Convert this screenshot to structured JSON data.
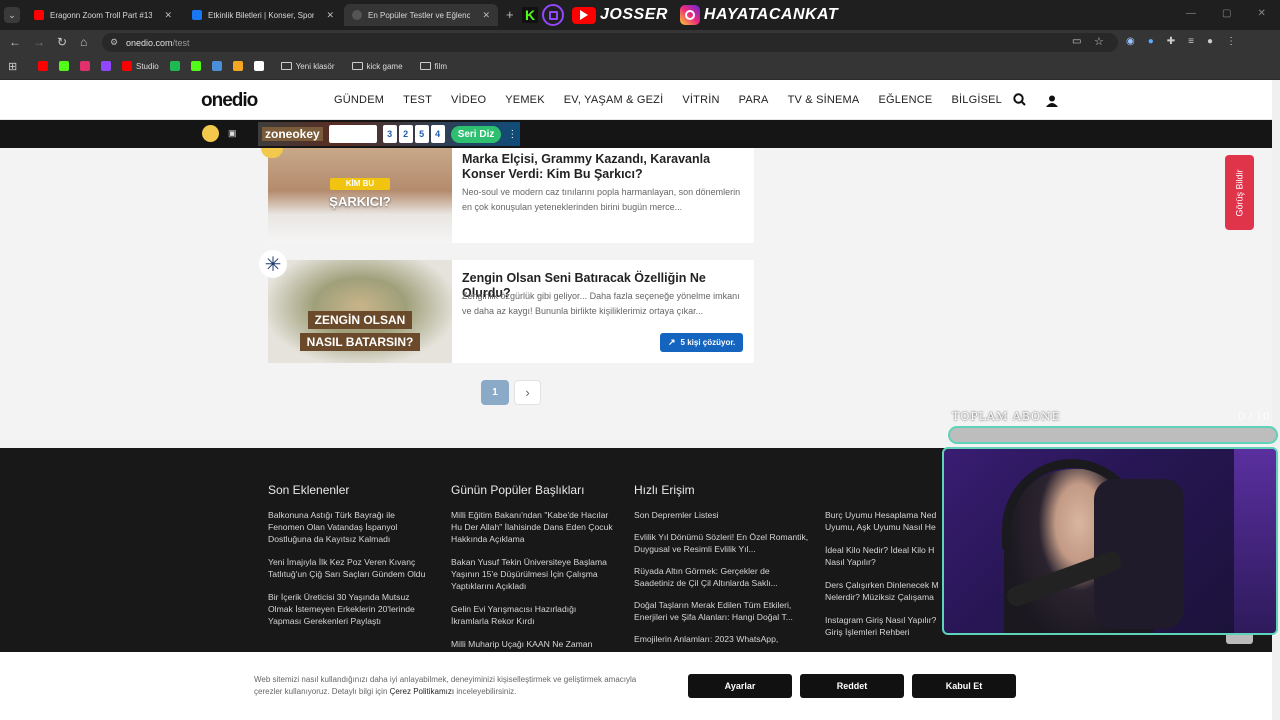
{
  "browser": {
    "tabs": [
      {
        "title": "Eragonn Zoom Troll Part #13 - Y",
        "favicon_color": "#ff0000"
      },
      {
        "title": "Etkinlik Biletleri | Konser, Spor, T",
        "favicon_color": "#1877f2"
      },
      {
        "title": "En Popüler Testler ve Eğlenceli T",
        "favicon_color": "#222222"
      }
    ],
    "new_tab": "+",
    "overlay_names": [
      "JOSSER",
      "HAYATACANKAT"
    ],
    "url_host": "onedio.com",
    "url_path": "/test",
    "bookmarks": [
      {
        "label": "",
        "color": "#ff0000"
      },
      {
        "label": "",
        "color": "#53fc18"
      },
      {
        "label": "",
        "color": "#e1306c"
      },
      {
        "label": "",
        "color": "#9146ff"
      },
      {
        "label": "Studio",
        "color": "#ff0000"
      },
      {
        "label": "",
        "color": "#1db954"
      },
      {
        "label": "",
        "color": "#53fc18"
      },
      {
        "label": "",
        "color": "#4a90d9"
      },
      {
        "label": "",
        "color": "#f5a623"
      },
      {
        "label": "",
        "color": "#ffffff"
      },
      {
        "label": "Yeni klasör",
        "color": "folder"
      },
      {
        "label": "kick game",
        "color": "folder"
      },
      {
        "label": "film",
        "color": "folder"
      }
    ]
  },
  "site": {
    "logo": "onedio",
    "menu": [
      "GÜNDEM",
      "TEST",
      "VİDEO",
      "YEMEK",
      "EV, YAŞAM & GEZİ",
      "VİTRİN",
      "PARA",
      "TV & SİNEMA",
      "EĞLENCE",
      "BİLGİSEL"
    ],
    "ad": {
      "brand": "zoneokey",
      "tiles": [
        "3",
        "2",
        "5",
        "4"
      ],
      "cta": "Seri Diz"
    },
    "cards": [
      {
        "title": "Marka Elçisi, Grammy Kazandı, Karavanla Konser Verdi: Kim Bu Şarkıcı?",
        "desc": "Neo-soul ve modern caz tınılarını popla harmanlayan, son dönemlerin en çok konuşulan yeteneklerinden birini bugün merce...",
        "img_small": "KİM BU",
        "img_big": "ŞARKICI?"
      },
      {
        "title": "Zengin Olsan Seni Batıracak Özelliğin Ne Olurdu?",
        "desc": "Zenginlik özgürlük gibi geliyor... Daha fazla seçeneğe yönelme imkanı ve daha az kaygı! Bununla birlikte kişiliklerimiz ortaya çıkar...",
        "img_line1": "ZENGİN OLSAN",
        "img_line2": "NASIL BATARSIN?",
        "badge": "5 kişi çözüyor."
      }
    ],
    "pagination": {
      "current": "1",
      "next": "›"
    },
    "feedback": "Görüş Bildir",
    "footer": {
      "columns": [
        {
          "heading": "Son Eklenenler",
          "links": [
            "Balkonuna Astığı Türk Bayrağı ile Fenomen Olan Vatandaş İspanyol Dostluğuna da Kayıtsız Kalmadı",
            "Yeni İmajıyla İlk Kez Poz Veren Kıvanç Tatlıtuğ'un Çiğ Sarı Saçları Gündem Oldu",
            "Bir İçerik Üreticisi 30 Yaşında Mutsuz Olmak İstemeyen Erkeklerin 20'lerinde Yapması Gerekenleri Paylaştı"
          ]
        },
        {
          "heading": "Günün Popüler Başlıkları",
          "links": [
            "Milli Eğitim Bakanı'ndan \"Kabe'de Hacılar Hu Der Allah\" İlahisinde Dans Eden Çocuk Hakkında Açıklama",
            "Bakan Yusuf Tekin Üniversiteye Başlama Yaşının 15'e Düşürülmesi İçin Çalışma Yaptıklarını Açıkladı",
            "Gelin Evi Yarışmacısı Hazırladığı İkramlarla Rekor Kırdı",
            "Milli Muharip Uçağı KAAN Ne Zaman"
          ]
        },
        {
          "heading": "Hızlı Erişim",
          "links": [
            "Son Depremler Listesi",
            "Evlilik Yıl Dönümü Sözleri! En Özel Romantik, Duygusal ve Resimli Evlilik Yıl...",
            "Rüyada Altın Görmek: Gerçekler de Saadetiniz de Çil Çil Altınlarda Saklı...",
            "Doğal Taşların Merak Edilen Tüm Etkileri, Enerjileri ve Şifa Alanları: Hangi Doğal T...",
            "Emojilerin Anlamları: 2023 WhatsApp,"
          ]
        },
        {
          "heading": "",
          "links": [
            "Burç Uyumu Hesaplama Ned Uyumu, Aşk Uyumu Nasıl He",
            "İdeal Kilo Nedir? İdeal Kilo H Nasıl Yapılır?",
            "Ders Çalışırken Dinlenecek M Nelerdir? Müziksiz Çalışama",
            "Instagram Giriş Nasıl Yapılır? Giriş İşlemleri Rehberi"
          ]
        }
      ]
    },
    "cookie": {
      "text1": "Web sitemizi nasıl kullandığınızı daha iyi anlayabilmek, deneyiminizi kişiselleştirmek ve geliştirmek amacıyla",
      "text2": "çerezler kullanıyoruz. Detaylı bilgi için",
      "link": "Çerez Politikamızı",
      "text3": "inceleyebilirsiniz.",
      "buttons": [
        "Ayarlar",
        "Reddet",
        "Kabul Et"
      ]
    }
  },
  "stream": {
    "subscriber_label": "TOPLAM ABONE",
    "subscriber_count": "0 / 10",
    "subscriber_progress": 0
  }
}
